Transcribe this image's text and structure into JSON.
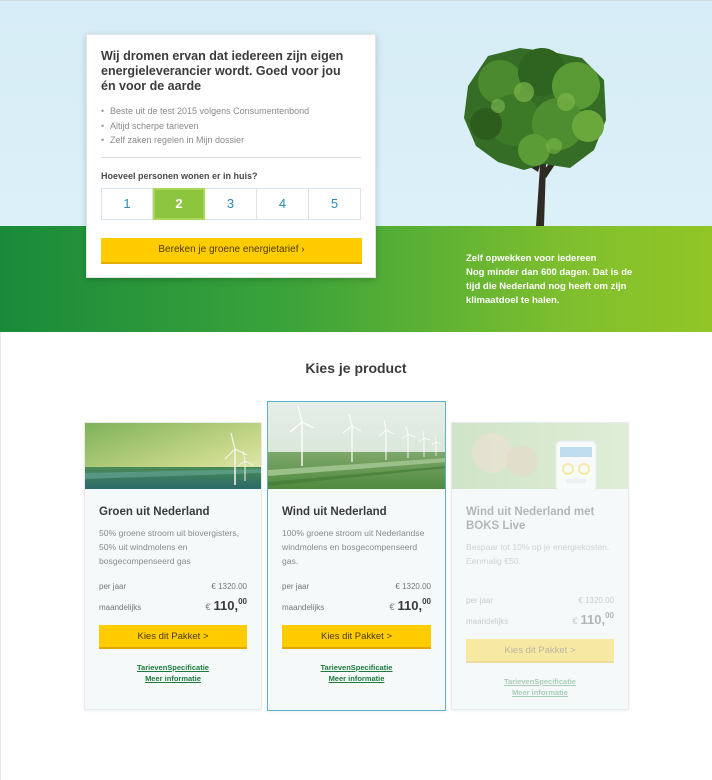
{
  "hero": {
    "card_title": "Wij dromen ervan dat iedereen zijn eigen energieleverancier wordt. Goed voor jou én voor de aarde",
    "bullets": [
      "Beste uit de test 2015 volgens Consumentenbond",
      "Altijd scherpe tarieven",
      "Zelf zaken regelen in Mijn dossier"
    ],
    "question": "Hoeveel personen wonen er in huis?",
    "persons": [
      "1",
      "2",
      "3",
      "4",
      "5"
    ],
    "selected_person": "2",
    "calc_button": "Bereken je groene energietarief ›",
    "side_title": "Zelf opwekken voor iedereen",
    "side_text": "Nog minder dan 600 dagen. Dat is de tijd die Nederland nog heeft om zijn klimaatdoel te halen."
  },
  "products_title": "Kies je product",
  "products": [
    {
      "title": "Groen uit Nederland",
      "desc": "50% groene stroom uit biovergisters, 50% uit windmolens en bosgecompenseerd gas",
      "year_label": "per jaar",
      "year_value": "€ 1320.00",
      "month_label": "maandelijks",
      "month_currency": "€",
      "month_value": "110,",
      "month_cents": "00",
      "button": "Kies dit Pakket >",
      "link1": "TarievenSpecificatie",
      "link2": "Meer informatie"
    },
    {
      "title": "Wind uit Nederland",
      "desc": "100% groene stroom uit Nederlandse windmolens en bosgecompenseerd gas.",
      "year_label": "per jaar",
      "year_value": "€ 1320.00",
      "month_label": "maandelijks",
      "month_currency": "€",
      "month_value": "110,",
      "month_cents": "00",
      "button": "Kies dit Pakket >",
      "link1": "TarievenSpecificatie",
      "link2": "Meer informatie"
    },
    {
      "title": "Wind uit Nederland met BOKS Live",
      "desc": "Bespaar tot 10% op je energiekosten. Eenmalig €50.",
      "year_label": "per jaar",
      "year_value": "€ 1320.00",
      "month_label": "maandelijks",
      "month_currency": "€",
      "month_value": "110,",
      "month_cents": "00",
      "button": "Kies dit Pakket >",
      "link1": "TarievenSpecificatie",
      "link2": "Meer informatie"
    }
  ],
  "colors": {
    "accent_yellow": "#ffcc00",
    "selected_green": "#8cc63f",
    "link_green": "#1d7a3c",
    "number_blue": "#2a8bb5",
    "featured_border": "#5bb2c9"
  }
}
